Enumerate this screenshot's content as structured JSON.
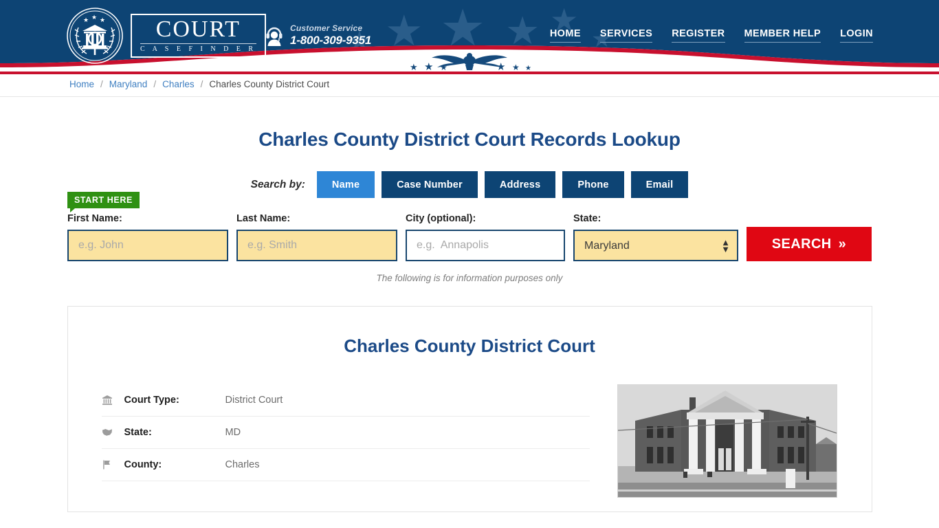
{
  "header": {
    "logo": {
      "word": "COURT",
      "sub": "C A S E   F I N D E R",
      "emblem_icon": "court-emblem-icon"
    },
    "customer_service": {
      "label": "Customer Service",
      "phone": "1-800-309-9351",
      "icon": "headset-support-icon"
    },
    "nav": [
      {
        "label": "HOME"
      },
      {
        "label": "SERVICES"
      },
      {
        "label": "REGISTER"
      },
      {
        "label": "MEMBER HELP"
      },
      {
        "label": "LOGIN"
      }
    ],
    "colors": {
      "navy": "#0d4474",
      "red": "#c8102e",
      "star": "#2a5d8a"
    }
  },
  "breadcrumb": {
    "items": [
      {
        "label": "Home",
        "link": true
      },
      {
        "label": "Maryland",
        "link": true
      },
      {
        "label": "Charles",
        "link": true
      },
      {
        "label": "Charles County District Court",
        "link": false
      }
    ],
    "separator": "/"
  },
  "main": {
    "page_title": "Charles County District Court Records Lookup",
    "search_by_label": "Search by:",
    "tabs": [
      {
        "label": "Name",
        "active": true
      },
      {
        "label": "Case Number",
        "active": false
      },
      {
        "label": "Address",
        "active": false
      },
      {
        "label": "Phone",
        "active": false
      },
      {
        "label": "Email",
        "active": false
      }
    ],
    "start_here_badge": "START HERE",
    "form": {
      "first_name": {
        "label": "First Name:",
        "placeholder": "e.g. John",
        "value": ""
      },
      "last_name": {
        "label": "Last Name:",
        "placeholder": "e.g. Smith",
        "value": ""
      },
      "city": {
        "label": "City (optional):",
        "placeholder": "e.g.  Annapolis",
        "value": ""
      },
      "state": {
        "label": "State:",
        "selected": "Maryland"
      },
      "search_button": "SEARCH",
      "search_button_chevron": "»"
    },
    "disclaimer": "The following is for information purposes only"
  },
  "card": {
    "title": "Charles County District Court",
    "details": [
      {
        "icon": "bank-building-icon",
        "glyph": "🏛",
        "label": "Court Type:",
        "value": "District Court"
      },
      {
        "icon": "map-state-icon",
        "glyph": "⚑",
        "label": "State:",
        "value": "MD"
      },
      {
        "icon": "flag-icon",
        "glyph": "⚐",
        "label": "County:",
        "value": "Charles"
      }
    ],
    "photo_alt": "courthouse-photo"
  },
  "colors": {
    "accent_blue": "#2e86d6",
    "navy": "#0d4474",
    "title_blue": "#1b4a87",
    "search_red": "#e00713",
    "badge_green": "#2f9113",
    "input_yellow": "#fbe3a0"
  }
}
